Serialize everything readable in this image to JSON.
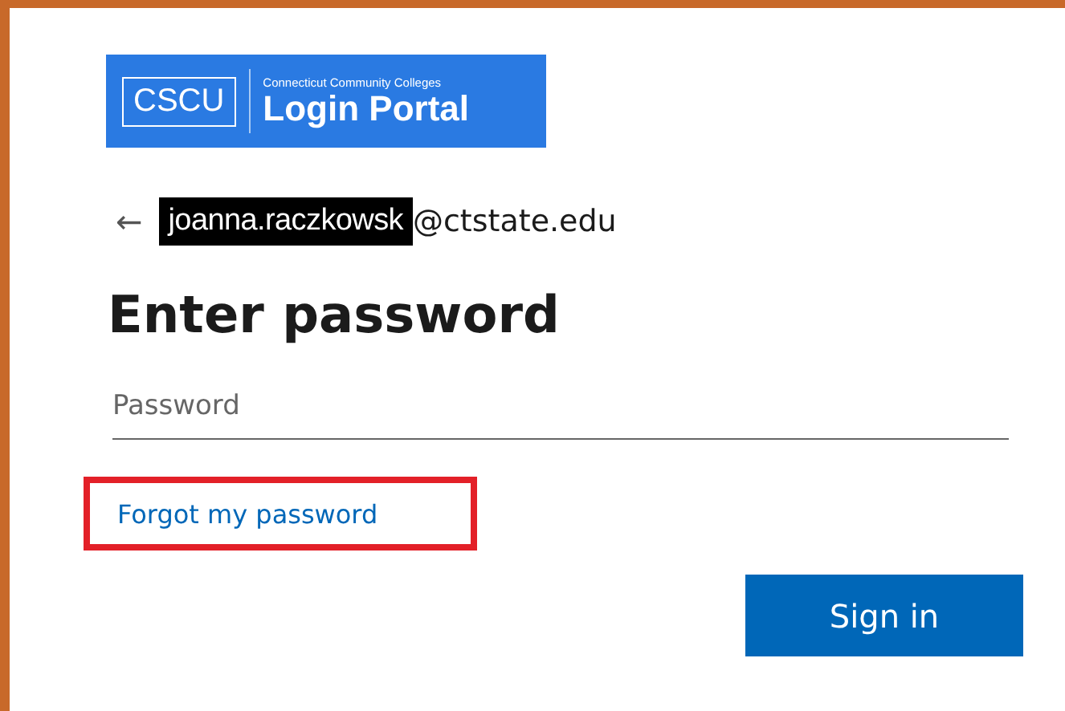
{
  "logo": {
    "short": "CSCU",
    "subtitle": "Connecticut Community Colleges",
    "title": "Login Portal"
  },
  "identity": {
    "back": "←",
    "name": "joanna.raczkowsk",
    "domain": "@ctstate.edu"
  },
  "heading": "Enter password",
  "password": {
    "placeholder": "Password"
  },
  "forgot_link": {
    "label": "Forgot my password",
    "highlighted": true
  },
  "sign_in": {
    "label": "Sign in"
  }
}
